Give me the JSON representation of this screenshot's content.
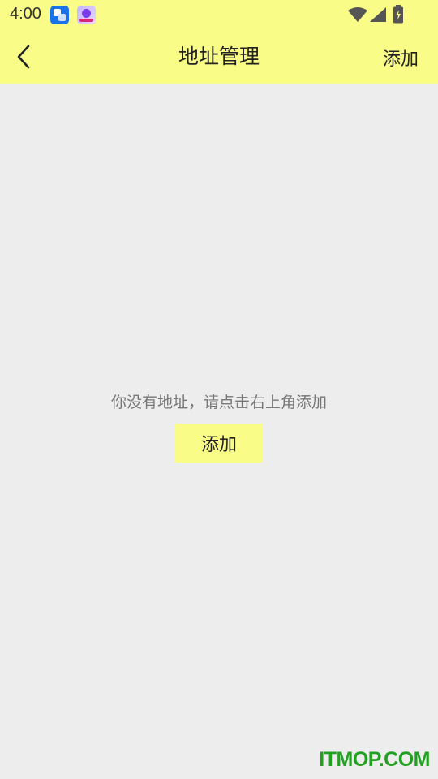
{
  "status_bar": {
    "time": "4:00",
    "notification_icons": [
      "translate-app-icon",
      "game-app-icon"
    ],
    "system_icons": [
      "wifi-icon",
      "cell-signal-icon",
      "battery-charging-icon"
    ]
  },
  "header": {
    "back_icon": "chevron-left-icon",
    "title": "地址管理",
    "add_label": "添加",
    "background": "#f9fd87"
  },
  "empty_state": {
    "message": "你没有地址，请点击右上角添加",
    "add_button_label": "添加"
  },
  "watermark": {
    "text": "ITMOP.COM",
    "color": "#22a022"
  },
  "colors": {
    "accent": "#f9fd87",
    "background": "#eeeded"
  }
}
